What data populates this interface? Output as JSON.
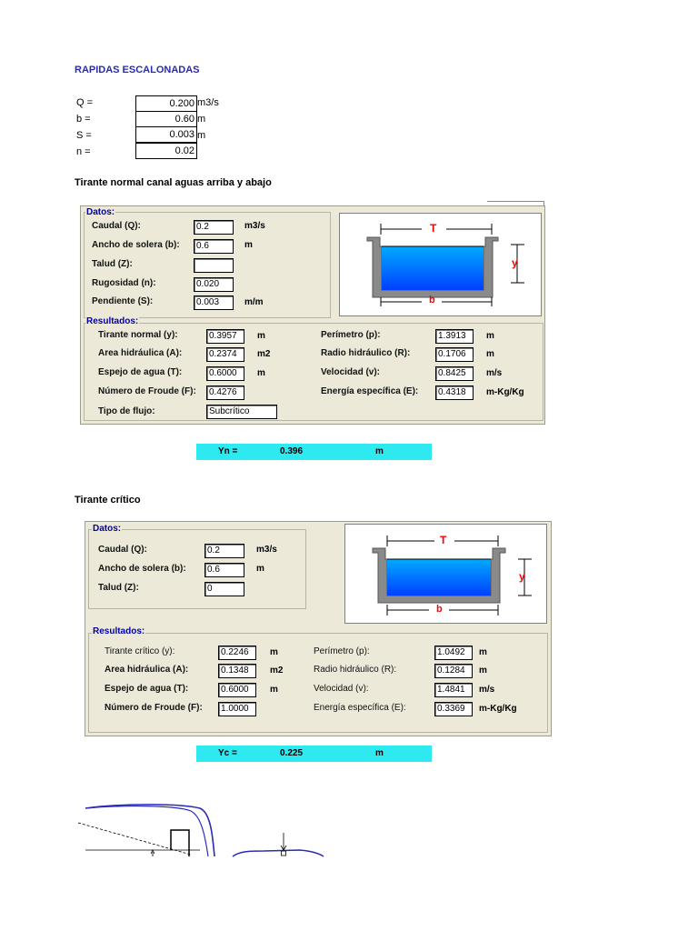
{
  "title": "RAPIDAS ESCALONADAS",
  "params": [
    {
      "label": "Q =",
      "value": "0.200",
      "unit": "m3/s"
    },
    {
      "label": "b =",
      "value": "0.60",
      "unit": "m"
    },
    {
      "label": "S =",
      "value": "0.003",
      "unit": "m"
    },
    {
      "label": "n =",
      "value": "0.02",
      "unit": ""
    }
  ],
  "section1": {
    "title": "Tirante normal canal aguas arriba y abajo",
    "datos_legend": "Datos:",
    "resultados_legend": "Resultados:",
    "inputs": [
      {
        "label": "Caudal (Q):",
        "value": "0.2",
        "unit": "m3/s"
      },
      {
        "label": "Ancho de solera (b):",
        "value": "0.6",
        "unit": "m"
      },
      {
        "label": "Talud (Z):",
        "value": "",
        "unit": ""
      },
      {
        "label": "Rugosidad (n):",
        "value": "0.020",
        "unit": ""
      },
      {
        "label": "Pendiente (S):",
        "value": "0.003",
        "unit": "m/m"
      }
    ],
    "results_left": [
      {
        "label": "Tirante normal (y):",
        "value": "0.3957",
        "unit": "m"
      },
      {
        "label": "Area hidráulica (A):",
        "value": "0.2374",
        "unit": "m2"
      },
      {
        "label": "Espejo de agua (T):",
        "value": "0.6000",
        "unit": "m"
      },
      {
        "label": "Número de Froude (F):",
        "value": "0.4276",
        "unit": ""
      },
      {
        "label": "Tipo de flujo:",
        "value": "Subcrítico",
        "unit": ""
      }
    ],
    "results_right": [
      {
        "label": "Perímetro (p):",
        "value": "1.3913",
        "unit": "m"
      },
      {
        "label": "Radio hidráulico (R):",
        "value": "0.1706",
        "unit": "m"
      },
      {
        "label": "Velocidad (v):",
        "value": "0.8425",
        "unit": "m/s"
      },
      {
        "label": "Energía específica (E):",
        "value": "0.4318",
        "unit": "m-Kg/Kg"
      }
    ],
    "diagram": {
      "top": "T",
      "side": "y",
      "bottom": "b"
    },
    "summary": {
      "label": "Yn =",
      "value": "0.396",
      "unit": "m"
    }
  },
  "section2": {
    "title": "Tirante crítico",
    "datos_legend": "Datos:",
    "resultados_legend": "Resultados:",
    "inputs": [
      {
        "label": "Caudal (Q):",
        "value": "0.2",
        "unit": "m3/s"
      },
      {
        "label": "Ancho de solera (b):",
        "value": "0.6",
        "unit": "m"
      },
      {
        "label": "Talud (Z):",
        "value": "0",
        "unit": ""
      }
    ],
    "results_left": [
      {
        "label": "Tirante crítico (y):",
        "value": "0.2246",
        "unit": "m"
      },
      {
        "label": "Area hidráulica (A):",
        "value": "0.1348",
        "unit": "m2"
      },
      {
        "label": "Espejo de agua (T):",
        "value": "0.6000",
        "unit": "m"
      },
      {
        "label": "Número de Froude (F):",
        "value": "1.0000",
        "unit": ""
      }
    ],
    "results_right": [
      {
        "label": "Perímetro (p):",
        "value": "1.0492",
        "unit": "m"
      },
      {
        "label": "Radio hidráulico (R):",
        "value": "0.1284",
        "unit": "m"
      },
      {
        "label": "Velocidad (v):",
        "value": "1.4841",
        "unit": "m/s"
      },
      {
        "label": "Energía específica (E):",
        "value": "0.3369",
        "unit": "m-Kg/Kg"
      }
    ],
    "diagram": {
      "top": "T",
      "side": "y",
      "bottom": "b"
    },
    "summary": {
      "label": "Yc =",
      "value": "0.225",
      "unit": "m"
    }
  },
  "colors": {
    "water": "#0080ff",
    "summary_bar": "#2ee9f0",
    "diagram_label": "#ff0000",
    "title": "#2a2ab8"
  }
}
